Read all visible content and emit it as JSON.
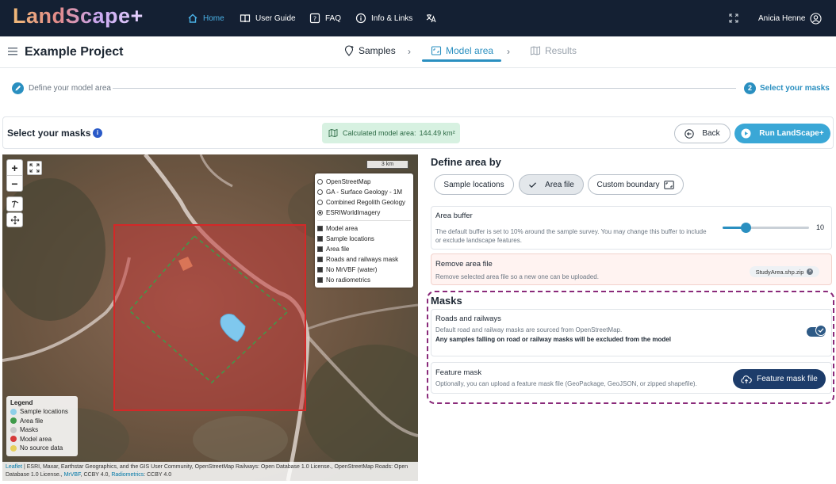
{
  "app": {
    "logo": "LandScape+",
    "nav": {
      "home": "Home",
      "user_guide": "User Guide",
      "faq": "FAQ",
      "info_links": "Info & Links"
    },
    "user_name": "Anicia Henne"
  },
  "project": {
    "title": "Example Project",
    "tabs": {
      "samples": "Samples",
      "model_area": "Model area",
      "results": "Results"
    }
  },
  "stepper": {
    "step1": "Define your model area",
    "step2_number": "2",
    "step2": "Select your masks"
  },
  "action_bar": {
    "title": "Select your masks",
    "calc_label": "Calculated model area:",
    "calc_value": "144.49 km²",
    "back": "Back",
    "run": "Run LandScape+"
  },
  "map": {
    "scale": "3 km",
    "base_layers": [
      {
        "label": "OpenStreetMap",
        "selected": false
      },
      {
        "label": "GA - Surface Geology - 1M",
        "selected": false
      },
      {
        "label": "Combined Regolith Geology",
        "selected": false
      },
      {
        "label": "ESRIWorldImagery",
        "selected": true
      }
    ],
    "overlays": [
      {
        "label": "Model area",
        "checked": true
      },
      {
        "label": "Sample locations",
        "checked": true
      },
      {
        "label": "Area file",
        "checked": true
      },
      {
        "label": "Roads and railways mask",
        "checked": true
      },
      {
        "label": "No MrVBF (water)",
        "checked": true
      },
      {
        "label": "No radiometrics",
        "checked": true
      }
    ],
    "legend": {
      "title": "Legend",
      "items": [
        {
          "label": "Sample locations",
          "color": "#8ecfe8"
        },
        {
          "label": "Area file",
          "color": "#3f9a4a"
        },
        {
          "label": "Masks",
          "color": "#c8c8c8"
        },
        {
          "label": "Model area",
          "color": "#d63a3a"
        },
        {
          "label": "No source data",
          "color": "#e6cf5a"
        }
      ]
    },
    "attribution": {
      "leaflet": "Leaflet",
      "text1": "| ESRI, Maxar, Earthstar Geographics, and the GIS User Community, OpenStreetMap Railways: Open Database 1.0 License., OpenStreetMap Roads: Open Database 1.0 License.,",
      "mrvbf": "MrVBF",
      "text2": ", CCBY 4.0,",
      "radiometrics": "Radiometrics",
      "text3": ": CCBY 4.0"
    }
  },
  "define_area": {
    "title": "Define area by",
    "options": {
      "samples": "Sample locations",
      "area_file": "Area file",
      "custom": "Custom boundary"
    },
    "selected": "area_file"
  },
  "area_buffer": {
    "title": "Area buffer",
    "description": "The default buffer is set to 10% around the sample survey. You may change this buffer to include or exclude landscape features.",
    "value": 10,
    "min": 0,
    "max": 100,
    "fill_fraction": 0.27
  },
  "remove_area": {
    "title": "Remove area file",
    "description": "Remove selected area file so a new one can be uploaded.",
    "file": "StudyArea.shp.zip"
  },
  "masks": {
    "title": "Masks",
    "roads": {
      "title": "Roads and railways",
      "description": "Default road and railway masks are sourced from OpenStreetMap.",
      "note": "Any samples falling on road or railway masks will be excluded from the model",
      "enabled": true
    },
    "feature": {
      "title": "Feature mask",
      "description": "Optionally, you can upload a feature mask file (GeoPackage, GeoJSON, or zipped shapefile).",
      "button": "Feature mask file"
    }
  }
}
